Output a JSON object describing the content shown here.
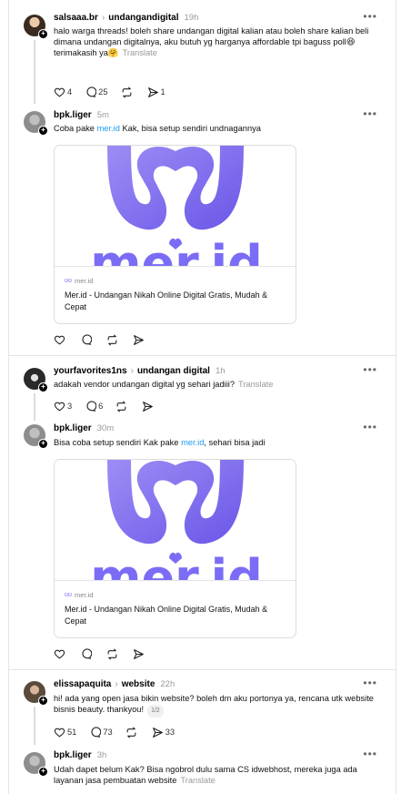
{
  "posts": [
    {
      "username": "salsaaa.br",
      "topic": "undangandigital",
      "time": "19h",
      "text": "halo warga threads! boleh share undangan digital kalian atau boleh share kalian beli dimana undangan digitalnya, aku butuh yg harganya affordable tpi baguss poll😆",
      "text2": "terimakasih ya🤗",
      "translate": "Translate",
      "likes": "4",
      "replies": "25",
      "reposts": "",
      "shares": "1"
    },
    {
      "username": "bpk.liger",
      "time": "5m",
      "text_pre": "Coba pake ",
      "link": "mer.id",
      "text_post": " Kak, bisa setup sendiri undnagannya",
      "card_domain": "mer.id",
      "card_title": "Mer.id - Undangan Nikah Online Digital Gratis, Mudah & Cepat",
      "logo_text": "mer.id"
    },
    {
      "username": "yourfavorites1ns",
      "topic": "undangan digital",
      "time": "1h",
      "text": "adakah vendor undangan digital yg sehari jadiii?",
      "translate": "Translate",
      "likes": "3",
      "replies": "6"
    },
    {
      "username": "bpk.liger",
      "time": "30m",
      "text_pre": "Bisa coba setup sendiri Kak pake ",
      "link": "mer.id",
      "text_post": ", sehari bisa jadi",
      "card_domain": "mer.id",
      "card_title": "Mer.id - Undangan Nikah Online Digital Gratis, Mudah & Cepat",
      "logo_text": "mer.id"
    },
    {
      "username": "elissapaquita",
      "topic": "website",
      "time": "22h",
      "text": "hi! ada yang open jasa bikin website? boleh dm aku portonya ya, rencana utk website bisnis beauty. thankyou!",
      "page_badge": "1/2",
      "likes": "51",
      "replies": "73",
      "shares": "33"
    },
    {
      "username": "bpk.liger",
      "time": "3h",
      "text": "Udah dapet belum Kak? Bisa ngobrol dulu sama CS idwebhost, mereka juga ada layanan jasa pembuatan website",
      "translate": "Translate"
    }
  ],
  "colors": {
    "link": "#1d9bf0",
    "brand": "#7b6cf6"
  },
  "icons": {
    "more": "more-icon",
    "like": "heart-icon",
    "reply": "comment-icon",
    "repost": "repost-icon",
    "share": "send-icon"
  }
}
